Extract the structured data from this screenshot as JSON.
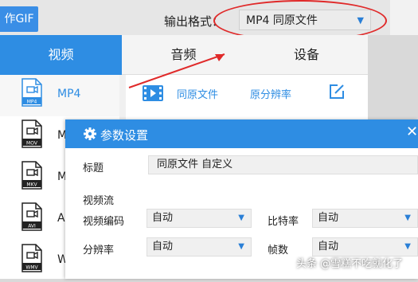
{
  "toolbar": {
    "gif_button": "作GIF",
    "output_format_label": "输出格式：",
    "output_format_value": "MP4  同原文件"
  },
  "tabs": [
    {
      "label": "视频",
      "active": true
    },
    {
      "label": "音频",
      "active": false
    },
    {
      "label": "设备",
      "active": false
    }
  ],
  "formats": [
    {
      "name": "MP4",
      "icon_text": "MP4",
      "selected": true
    },
    {
      "name": "M",
      "icon_text": "MOV",
      "selected": false
    },
    {
      "name": "M",
      "icon_text": "MKV",
      "selected": false
    },
    {
      "name": "A",
      "icon_text": "AVI",
      "selected": false
    },
    {
      "name": "W",
      "icon_text": "WMV",
      "selected": false
    }
  ],
  "preset": {
    "name": "同原文件",
    "resolution": "原分辨率",
    "edit_icon": "edit-icon"
  },
  "dialog": {
    "title": "参数设置",
    "title_label": "标题",
    "title_value": "同原文件 自定义",
    "video_stream_label": "视频流",
    "fields": {
      "video_codec_label": "视频编码",
      "video_codec_value": "自动",
      "bitrate_label": "比特率",
      "bitrate_value": "自动",
      "resolution_label": "分辨率",
      "resolution_value": "自动",
      "framerate_label": "帧数",
      "framerate_value": "自动"
    }
  },
  "watermark": "头条 @雪糕不吃就化了",
  "colors": {
    "accent": "#2e8de3",
    "annotation": "#e02a2a"
  }
}
